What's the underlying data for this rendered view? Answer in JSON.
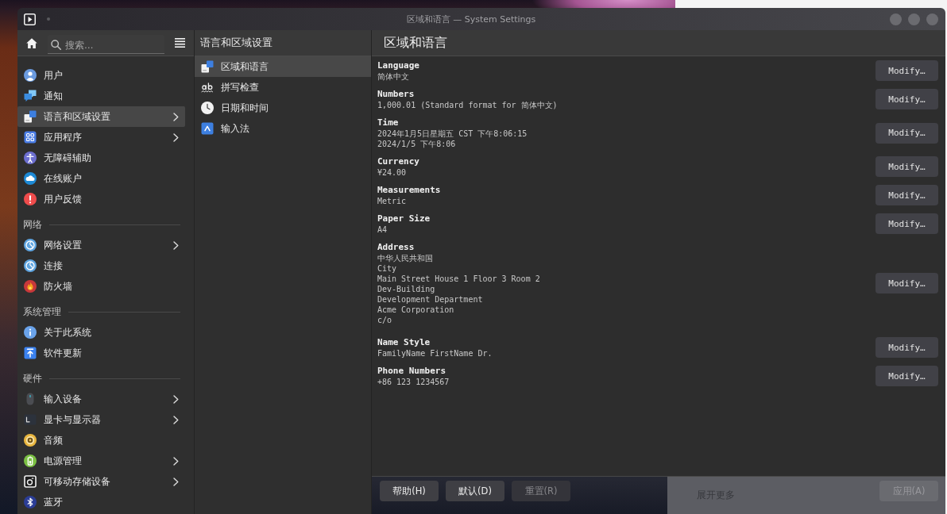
{
  "window": {
    "title": "区域和语言 — System Settings"
  },
  "sidebar": {
    "search": {
      "placeholder": "搜索…"
    },
    "sections": [
      {
        "items": [
          {
            "label": "用户",
            "selected": false,
            "expandable": false
          },
          {
            "label": "通知",
            "selected": false,
            "expandable": false
          },
          {
            "label": "语言和区域设置",
            "selected": true,
            "expandable": true
          },
          {
            "label": "应用程序",
            "selected": false,
            "expandable": true
          },
          {
            "label": "无障碍辅助",
            "selected": false,
            "expandable": false
          },
          {
            "label": "在线账户",
            "selected": false,
            "expandable": false
          },
          {
            "label": "用户反馈",
            "selected": false,
            "expandable": false
          }
        ]
      },
      {
        "title": "网络",
        "items": [
          {
            "label": "网络设置",
            "selected": false,
            "expandable": true
          },
          {
            "label": "连接",
            "selected": false,
            "expandable": false
          },
          {
            "label": "防火墙",
            "selected": false,
            "expandable": false
          }
        ]
      },
      {
        "title": "系统管理",
        "items": [
          {
            "label": "关于此系统",
            "selected": false,
            "expandable": false
          },
          {
            "label": "软件更新",
            "selected": false,
            "expandable": false
          }
        ]
      },
      {
        "title": "硬件",
        "items": [
          {
            "label": "输入设备",
            "selected": false,
            "expandable": true
          },
          {
            "label": "显卡与显示器",
            "selected": false,
            "expandable": true
          },
          {
            "label": "音频",
            "selected": false,
            "expandable": false
          },
          {
            "label": "电源管理",
            "selected": false,
            "expandable": true
          },
          {
            "label": "可移动存储设备",
            "selected": false,
            "expandable": true
          },
          {
            "label": "蓝牙",
            "selected": false,
            "expandable": false
          }
        ]
      }
    ]
  },
  "subpage_list": {
    "title": "语言和区域设置",
    "items": [
      {
        "label": "区域和语言",
        "selected": true
      },
      {
        "label": "拼写检查",
        "selected": false
      },
      {
        "label": "日期和时间",
        "selected": false
      },
      {
        "label": "输入法",
        "selected": false
      }
    ]
  },
  "content": {
    "title": "区域和语言",
    "settings": [
      {
        "label": "Language",
        "values": [
          "简体中文"
        ],
        "button": "Modify…"
      },
      {
        "label": "Numbers",
        "values": [
          "1,000.01 (Standard format for 简体中文)"
        ],
        "button": "Modify…"
      },
      {
        "label": "Time",
        "values": [
          "2024年1月5日星期五 CST 下午8:06:15",
          "2024/1/5 下午8:06"
        ],
        "button": "Modify…"
      },
      {
        "label": "Currency",
        "values": [
          "¥24.00"
        ],
        "button": "Modify…"
      },
      {
        "label": "Measurements",
        "values": [
          "Metric"
        ],
        "button": "Modify…"
      },
      {
        "label": "Paper Size",
        "values": [
          "A4"
        ],
        "button": "Modify…"
      },
      {
        "label": "Address",
        "values": [
          "中华人民共和国",
          "City",
          "Main Street House 1 Floor 3 Room 2",
          "Dev-Building",
          "Development Department",
          "Acme Corporation",
          "c/o"
        ],
        "button": "Modify…"
      },
      {
        "label": "Name Style",
        "values": [
          "FamilyName FirstName Dr."
        ],
        "button": "Modify…"
      },
      {
        "label": "Phone Numbers",
        "values": [
          "+86 123 1234567"
        ],
        "button": "Modify…"
      }
    ]
  },
  "footer": {
    "buttons": [
      {
        "label": "帮助(H)",
        "disabled": false
      },
      {
        "label": "默认(D)",
        "disabled": false
      },
      {
        "label": "重置(R)",
        "disabled": true
      }
    ],
    "apply_button": {
      "label": "应用(A)",
      "disabled": true
    }
  },
  "background_window": {
    "text": "展开更多"
  }
}
